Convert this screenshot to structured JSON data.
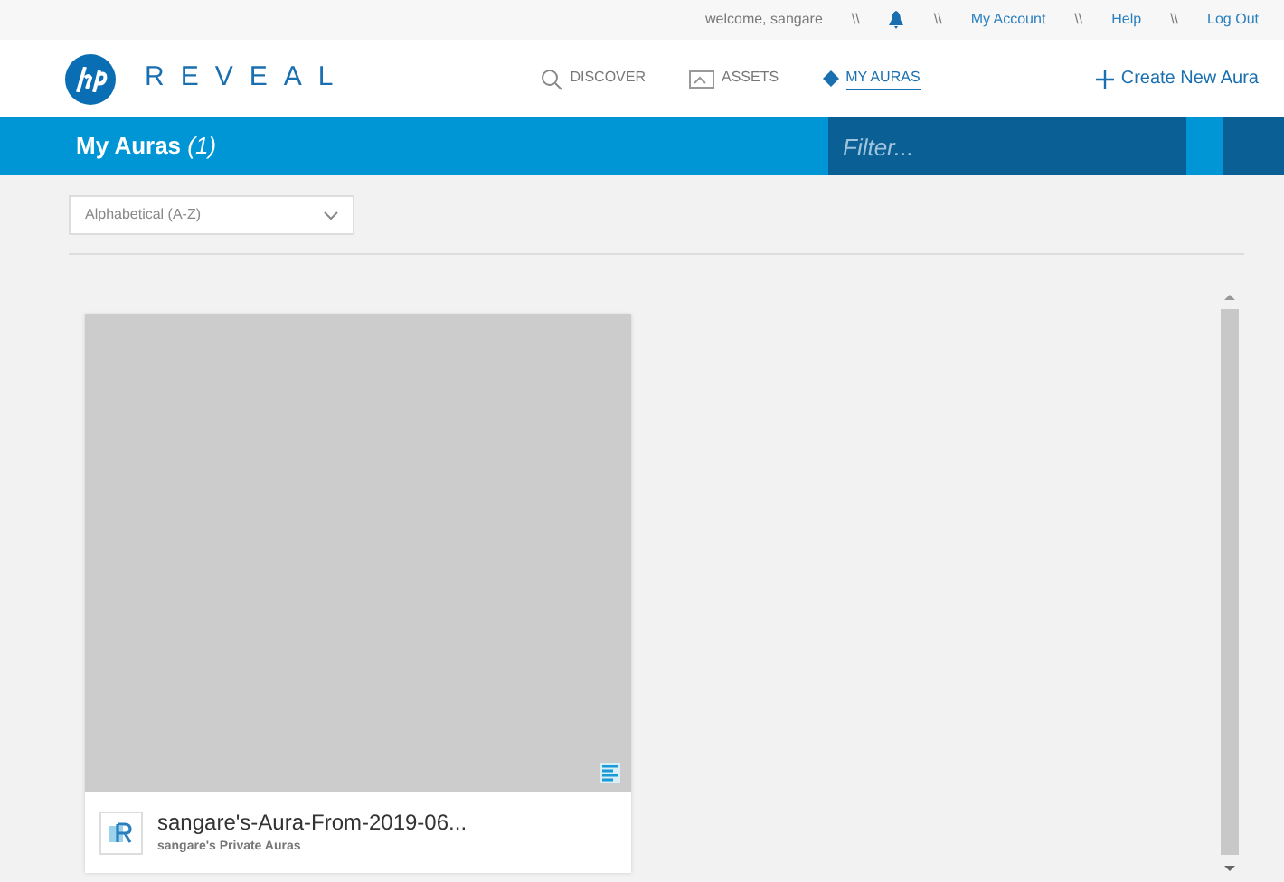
{
  "top_bar": {
    "welcome": "welcome, sangare",
    "links": [
      {
        "kind": "sep",
        "text": "\\\\"
      },
      {
        "kind": "bell"
      },
      {
        "kind": "sep",
        "text": "\\\\"
      },
      {
        "kind": "link",
        "text": "My Account"
      },
      {
        "kind": "sep",
        "text": "\\\\"
      },
      {
        "kind": "link",
        "text": "Help"
      },
      {
        "kind": "sep",
        "text": "\\\\"
      },
      {
        "kind": "link",
        "text": "Log Out"
      }
    ]
  },
  "logo": {
    "text": "REVEAL"
  },
  "nav": [
    {
      "label": "DISCOVER",
      "kind": "search",
      "selected": false
    },
    {
      "label": "ASSETS",
      "kind": "image",
      "selected": false
    },
    {
      "label": "MY AURAS",
      "kind": "diamond",
      "selected": true
    }
  ],
  "create_button": {
    "label": "Create New Aura"
  },
  "title_bar": {
    "title": "My Auras",
    "count": "(1)",
    "filter": {
      "placeholder": "Filter..."
    }
  },
  "sort": {
    "value": "Alphabetical (A-Z)"
  },
  "auras": [
    {
      "title": "sangare's-Aura-From-2019-06...",
      "subtitle": "sangare's Private Auras"
    }
  ]
}
